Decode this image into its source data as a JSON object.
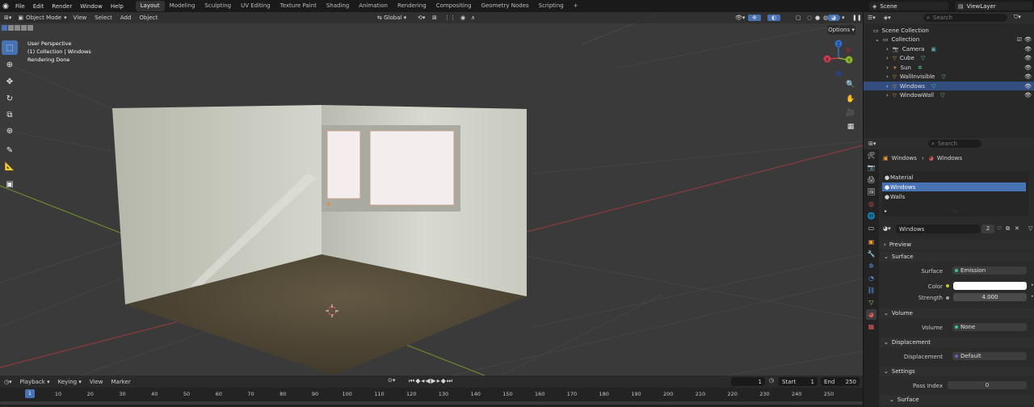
{
  "topbar": {
    "menus": [
      "File",
      "Edit",
      "Render",
      "Window",
      "Help"
    ],
    "workspaces": [
      "Layout",
      "Modeling",
      "Sculpting",
      "UV Editing",
      "Texture Paint",
      "Shading",
      "Animation",
      "Rendering",
      "Compositing",
      "Geometry Nodes",
      "Scripting"
    ],
    "active_workspace": "Layout",
    "add_tab": "+",
    "scene": "Scene",
    "view_layer": "ViewLayer"
  },
  "viewport": {
    "mode": "Object Mode",
    "menus": [
      "View",
      "Select",
      "Add",
      "Object"
    ],
    "orientation": "Global",
    "options_label": "Options",
    "overlay_lines": [
      "User Perspective",
      "(1) Collection | Windows",
      "Rendering Done"
    ],
    "gizmo": {
      "x": "X",
      "y": "Y",
      "z": "Z"
    },
    "colors": {
      "x_axis": "#c83c4b",
      "y_axis": "#8bb42d",
      "z_axis": "#2f6fd0",
      "wall": "#c7c9be",
      "floor": "#4b4231",
      "window": "#f3eded"
    }
  },
  "timeline": {
    "menus": [
      "Playback",
      "Keying",
      "View",
      "Marker"
    ],
    "current_frame": "1",
    "start_label": "Start",
    "start": "1",
    "end_label": "End",
    "end": "250",
    "playhead": "1",
    "ticks": [
      "10",
      "20",
      "30",
      "40",
      "50",
      "60",
      "70",
      "80",
      "90",
      "100",
      "110",
      "120",
      "130",
      "140",
      "150",
      "160",
      "170",
      "180",
      "190",
      "200",
      "210",
      "220",
      "230",
      "240",
      "250"
    ]
  },
  "outliner": {
    "search_placeholder": "Search",
    "root": "Scene Collection",
    "collection": "Collection",
    "items": [
      {
        "name": "Camera",
        "icon": "camera-icon"
      },
      {
        "name": "Cube",
        "icon": "mesh-icon"
      },
      {
        "name": "Sun",
        "icon": "light-icon"
      },
      {
        "name": "WallInvisible",
        "icon": "mesh-icon"
      },
      {
        "name": "Windows",
        "icon": "mesh-icon",
        "selected": true
      },
      {
        "name": "WindowWall",
        "icon": "mesh-icon"
      }
    ]
  },
  "properties": {
    "search_placeholder": "Search",
    "breadcrumb": [
      "Windows",
      "Windows"
    ],
    "slots": [
      "Material",
      "Windows",
      "Walls"
    ],
    "active_slot": "Windows",
    "material_name": "Windows",
    "users": "2",
    "panels": {
      "preview": "Preview",
      "surface": "Surface",
      "volume": "Volume",
      "displacement": "Displacement",
      "settings": "Settings",
      "surface2": "Surface"
    },
    "fields": {
      "surface_label": "Surface",
      "surface_value": "Emission",
      "color_label": "Color",
      "color_value": "#ffffff",
      "strength_label": "Strength",
      "strength_value": "4.000",
      "volume_label": "Volume",
      "volume_value": "None",
      "displacement_label": "Displacement",
      "displacement_value": "Default",
      "pass_index_label": "Pass Index",
      "pass_index_value": "0"
    }
  }
}
